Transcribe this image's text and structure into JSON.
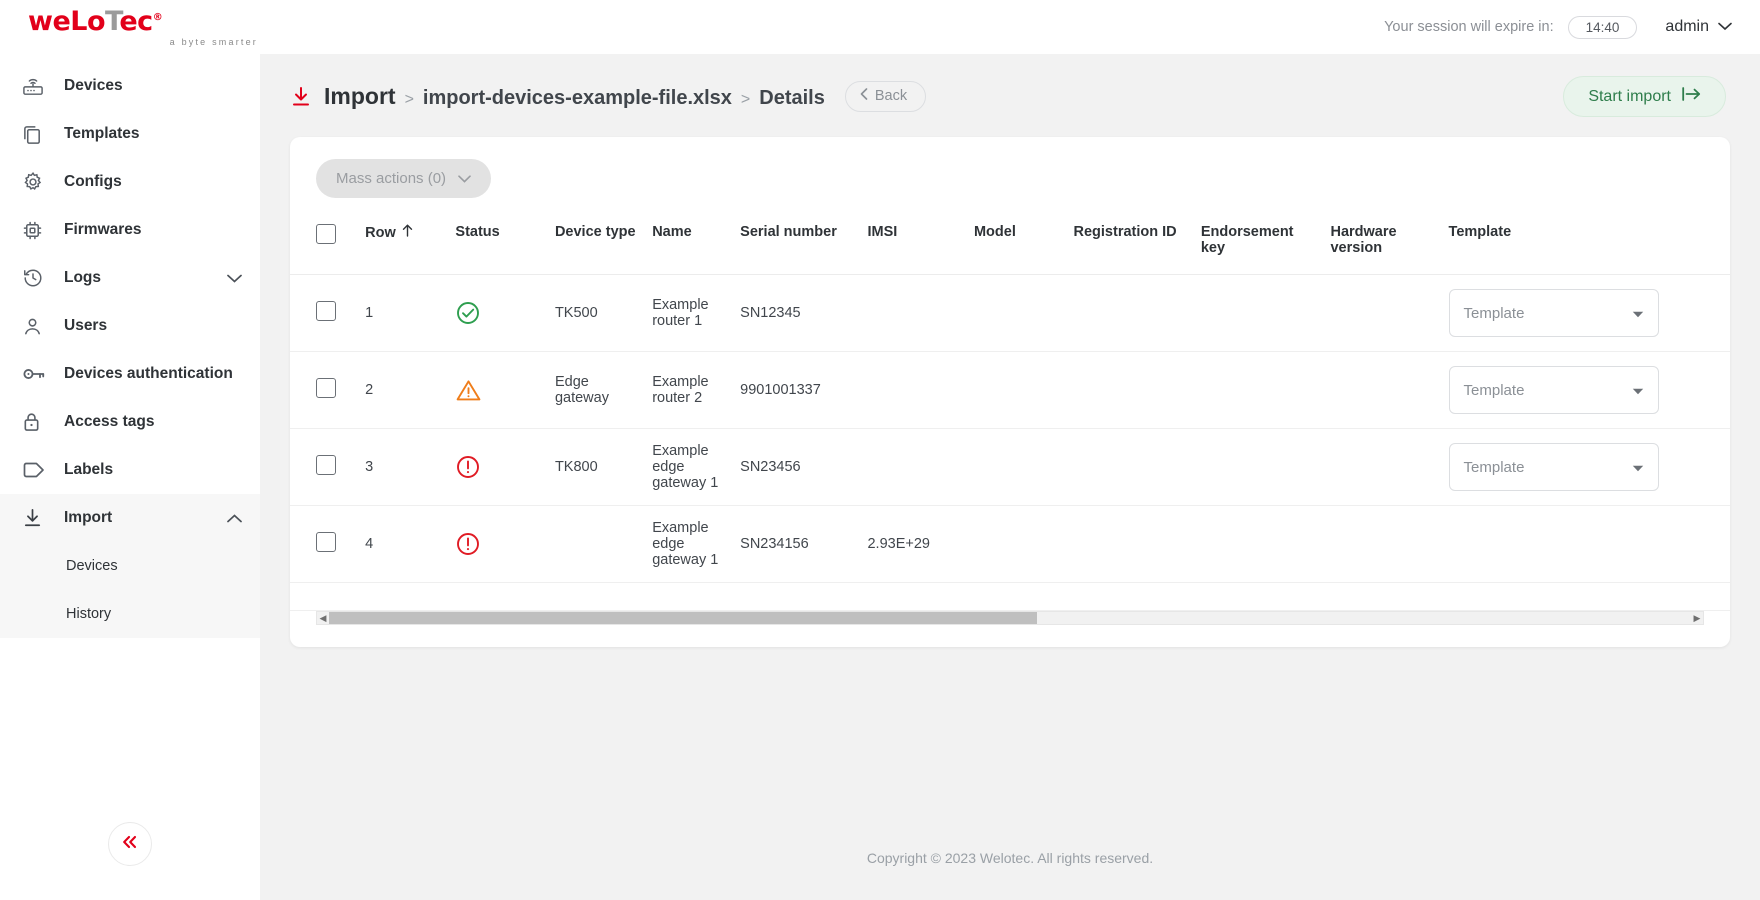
{
  "brand": {
    "logo_text_1": "weLo",
    "logo_text_2": "T",
    "logo_text_3": "ec",
    "logo_reg": "®",
    "tagline": "a byte smarter",
    "accent_red": "#e2001a"
  },
  "topbar": {
    "session_label": "Your session will expire in:",
    "session_time": "14:40",
    "user": "admin"
  },
  "sidebar": {
    "items": [
      {
        "label": "Devices",
        "icon": "router-icon",
        "expandable": false
      },
      {
        "label": "Templates",
        "icon": "copy-icon",
        "expandable": false
      },
      {
        "label": "Configs",
        "icon": "gear-icon",
        "expandable": false
      },
      {
        "label": "Firmwares",
        "icon": "chip-icon",
        "expandable": false
      },
      {
        "label": "Logs",
        "icon": "history-icon",
        "expandable": true
      },
      {
        "label": "Users",
        "icon": "user-icon",
        "expandable": false
      },
      {
        "label": "Devices authentication",
        "icon": "key-icon",
        "expandable": false
      },
      {
        "label": "Access tags",
        "icon": "lock-icon",
        "expandable": false
      },
      {
        "label": "Labels",
        "icon": "tag-icon",
        "expandable": false
      },
      {
        "label": "Import",
        "icon": "import-icon",
        "expandable": true
      }
    ],
    "import_children": [
      {
        "label": "Devices"
      },
      {
        "label": "History"
      }
    ],
    "collapse_icon": "double-chevron-left-icon"
  },
  "page": {
    "title_icon": "import-icon",
    "breadcrumb": {
      "root": "Import",
      "sep": ">",
      "file": "import-devices-example-file.xlsx",
      "current": "Details"
    },
    "back_label": "Back",
    "start_import_label": "Start import",
    "mass_actions_label": "Mass actions (0)"
  },
  "table": {
    "columns": [
      {
        "key": "checkbox",
        "label": "",
        "cls": "col-cb"
      },
      {
        "key": "row",
        "label": "Row",
        "cls": "col-row",
        "sorted": "asc"
      },
      {
        "key": "status",
        "label": "Status",
        "cls": "col-status"
      },
      {
        "key": "device_type",
        "label": "Device type",
        "cls": "col-dtype"
      },
      {
        "key": "name",
        "label": "Name",
        "cls": "col-name"
      },
      {
        "key": "serial_number",
        "label": "Serial number",
        "cls": "col-serial"
      },
      {
        "key": "imsi",
        "label": "IMSI",
        "cls": "col-imsi"
      },
      {
        "key": "model",
        "label": "Model",
        "cls": "col-model"
      },
      {
        "key": "registration_id",
        "label": "Registration ID",
        "cls": "col-reg"
      },
      {
        "key": "endorsement_key",
        "label": "Endorsement key",
        "cls": "col-end"
      },
      {
        "key": "hardware_version",
        "label": "Hardware version",
        "cls": "col-hw"
      },
      {
        "key": "template",
        "label": "Template",
        "cls": "col-tpl"
      }
    ],
    "rows": [
      {
        "row": "1",
        "status": "ok",
        "device_type": "TK500",
        "name": "Example router 1",
        "serial_number": "SN12345",
        "imsi": "",
        "model": "",
        "registration_id": "",
        "endorsement_key": "",
        "hardware_version": "",
        "template_placeholder": "Template"
      },
      {
        "row": "2",
        "status": "warning",
        "device_type": "Edge gateway",
        "name": "Example router 2",
        "serial_number": "9901001337",
        "imsi": "",
        "model": "",
        "registration_id": "",
        "endorsement_key": "",
        "hardware_version": "",
        "template_placeholder": "Template"
      },
      {
        "row": "3",
        "status": "error",
        "device_type": "TK800",
        "name": "Example edge gateway 1",
        "serial_number": "SN23456",
        "imsi": "",
        "model": "",
        "registration_id": "",
        "endorsement_key": "",
        "hardware_version": "",
        "template_placeholder": "Template"
      },
      {
        "row": "4",
        "status": "error",
        "device_type": "",
        "name": "Example edge gateway 1",
        "serial_number": "SN234156",
        "imsi": "2.93E+29",
        "model": "",
        "registration_id": "",
        "endorsement_key": "",
        "hardware_version": "",
        "template_placeholder": ""
      }
    ],
    "status_colors": {
      "ok": "#2e9e4f",
      "warning": "#ef7d1a",
      "error": "#e01b24"
    }
  },
  "scrollbar": {
    "thumb_percent": 52
  },
  "footer": {
    "copyright": "Copyright © 2023 Welotec. All rights reserved."
  }
}
